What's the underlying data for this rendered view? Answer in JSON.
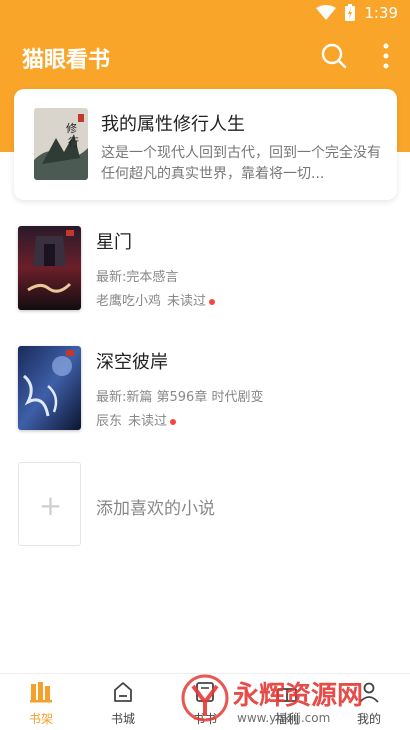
{
  "status": {
    "time": "1:39"
  },
  "header": {
    "title": "猫眼看书",
    "icons": [
      "search-icon",
      "more-vertical-icon"
    ]
  },
  "colors": {
    "accent": "#f9a52a",
    "tab_active": "#f5a02a",
    "unread_dot": "#f5483c"
  },
  "featured": {
    "title": "我的属性修行人生",
    "description": "这是一个现代人回到古代，回到一个完全没有任何超凡的真实世界，靠着将一切..."
  },
  "books": [
    {
      "title": "星门",
      "latest": "最新:完本感言",
      "author": "老鹰吃小鸡",
      "status": "未读过"
    },
    {
      "title": "深空彼岸",
      "latest": "最新:新篇 第596章 时代剧变",
      "author": "辰东",
      "status": "未读过"
    }
  ],
  "add": {
    "plus": "+",
    "label": "添加喜欢的小说"
  },
  "tabs": [
    {
      "label": "书架",
      "icon": "bookshelf-icon",
      "active": true
    },
    {
      "label": "书城",
      "icon": "bookstore-icon",
      "active": false
    },
    {
      "label": "书书",
      "icon": "book-icon",
      "active": false
    },
    {
      "label": "福利",
      "icon": "gift-icon",
      "active": false
    },
    {
      "label": "我的",
      "icon": "user-icon",
      "active": false
    }
  ],
  "watermark": {
    "text": "永辉资源网",
    "url": "www.yhkjjj.com"
  }
}
